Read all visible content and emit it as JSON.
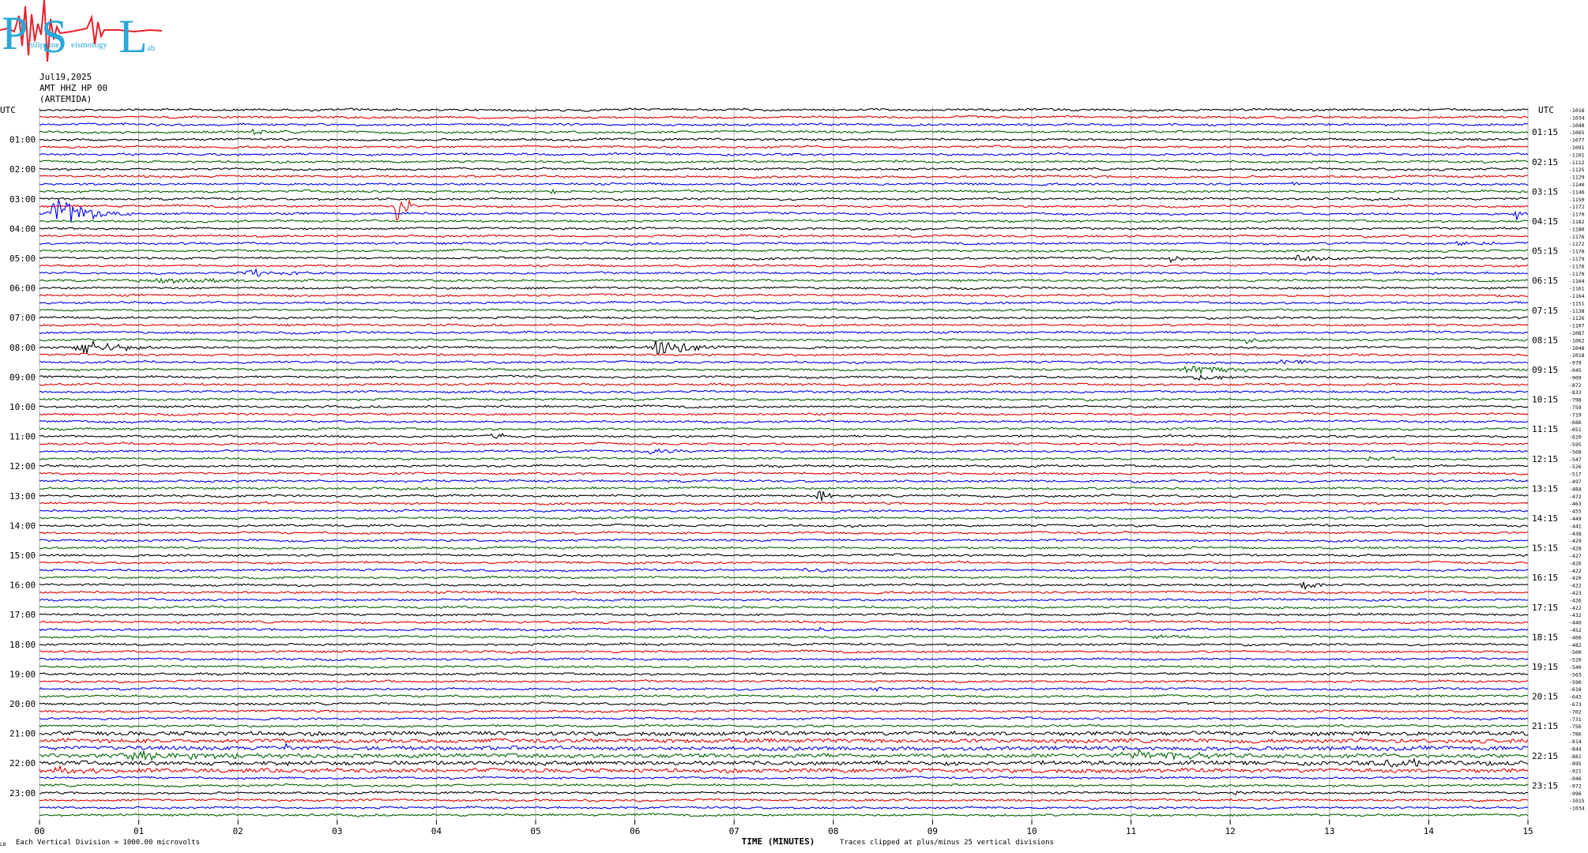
{
  "logo": {
    "big_letters": [
      "P",
      "S",
      "L"
    ],
    "small_words": [
      "hilippine",
      "eismology",
      "ab"
    ]
  },
  "header": {
    "date": "Jul19,2025",
    "channel": "AMT HHZ HP 00",
    "station": "(ARTEMIDA)"
  },
  "footer": {
    "scale_note": "Each Vertical Division = 1000.00 microvolts",
    "clip_note": "Traces clipped at plus/minus 25 vertical divisions",
    "corner_mark": "LB"
  },
  "colors": {
    "trace_cycle": [
      "#000000",
      "#e00000",
      "#0000ee",
      "#006400"
    ],
    "grid": "#b0b0b0"
  },
  "chart_data": {
    "type": "line",
    "title": "",
    "xlabel": "TIME (MINUTES)",
    "x_ticks": [
      "00",
      "01",
      "02",
      "03",
      "04",
      "05",
      "06",
      "07",
      "08",
      "09",
      "10",
      "11",
      "12",
      "13",
      "14",
      "15"
    ],
    "xlim": [
      0,
      15
    ],
    "left_axis_title": "UTC",
    "right_axis_title": "UTC",
    "left_hour_labels": [
      "01:00",
      "02:00",
      "03:00",
      "04:00",
      "05:00",
      "06:00",
      "07:00",
      "08:00",
      "09:00",
      "10:00",
      "11:00",
      "12:00",
      "13:00",
      "14:00",
      "15:00",
      "16:00",
      "17:00",
      "18:00",
      "19:00",
      "20:00",
      "21:00",
      "22:00",
      "23:00"
    ],
    "right_hour_labels": [
      "01:15",
      "02:15",
      "03:15",
      "04:15",
      "05:15",
      "06:15",
      "07:15",
      "08:15",
      "09:15",
      "10:15",
      "11:15",
      "12:15",
      "13:15",
      "14:15",
      "15:15",
      "16:15",
      "17:15",
      "18:15",
      "19:15",
      "20:15",
      "21:15",
      "22:15",
      "23:15"
    ],
    "trace_count": 96,
    "minutes_per_trace": 15,
    "right_offsets": [
      "-1016",
      "-1034",
      "-1048",
      "-1065",
      "-1077",
      "-1091",
      "-1101",
      "-1112",
      "-1125",
      "-1129",
      "-1140",
      "-1146",
      "-1150",
      "-1172",
      "-1170",
      "-1182",
      "-1180",
      "-1176",
      "-1172",
      "-1170",
      "-1179",
      "-1176",
      "-1170",
      "-1164",
      "-1161",
      "-1164",
      "-1151",
      "-1138",
      "-1126",
      "-1107",
      "-1087",
      "-1062",
      "-1048",
      "-1018",
      "-979",
      "-945",
      "-909",
      "-872",
      "-833",
      "-798",
      "-759",
      "-719",
      "-686",
      "-651",
      "-620",
      "-595",
      "-568",
      "-547",
      "-526",
      "-517",
      "-497",
      "-484",
      "-472",
      "-463",
      "-455",
      "-449",
      "-441",
      "-438",
      "-429",
      "-428",
      "-427",
      "-426",
      "-422",
      "-420",
      "-422",
      "-423",
      "-426",
      "-422",
      "-432",
      "-440",
      "-452",
      "-466",
      "-482",
      "-500",
      "-520",
      "-540",
      "-563",
      "-590",
      "-618",
      "-643",
      "-673",
      "-702",
      "-731",
      "-756",
      "-786",
      "-814",
      "-844",
      "-881",
      "-895",
      "-921",
      "-946",
      "-972",
      "-996",
      "-1015",
      "-1034"
    ],
    "events": [
      {
        "trace": 3,
        "minute": 2.1,
        "amplitude": 3.5,
        "duration": 0.35
      },
      {
        "trace": 2,
        "minute": 9.4,
        "amplitude": 2.5,
        "duration": 0.3
      },
      {
        "trace": 7,
        "minute": 8.6,
        "amplitude": 2.5,
        "duration": 0.2
      },
      {
        "trace": 10,
        "minute": 12.6,
        "amplitude": 4,
        "duration": 0.2
      },
      {
        "trace": 11,
        "minute": 5.1,
        "amplitude": 3,
        "duration": 0.5
      },
      {
        "trace": 13,
        "minute": 3.55,
        "amplitude": 22,
        "duration": 0.35
      },
      {
        "trace": 14,
        "minute": 0.05,
        "amplitude": 22,
        "duration": 0.9
      },
      {
        "trace": 14,
        "minute": 14.85,
        "amplitude": 13,
        "duration": 0.15
      },
      {
        "trace": 18,
        "minute": 14.2,
        "amplitude": 3,
        "duration": 0.8
      },
      {
        "trace": 20,
        "minute": 11.3,
        "amplitude": 4,
        "duration": 0.6
      },
      {
        "trace": 20,
        "minute": 12.6,
        "amplitude": 5,
        "duration": 0.7
      },
      {
        "trace": 22,
        "minute": 2.0,
        "amplitude": 5,
        "duration": 1.2
      },
      {
        "trace": 23,
        "minute": 0.8,
        "amplitude": 3,
        "duration": 2.8
      },
      {
        "trace": 32,
        "minute": 0.3,
        "amplitude": 10,
        "duration": 1.0
      },
      {
        "trace": 32,
        "minute": 6.1,
        "amplitude": 12,
        "duration": 1.0
      },
      {
        "trace": 31,
        "minute": 12.1,
        "amplitude": 4,
        "duration": 0.4
      },
      {
        "trace": 34,
        "minute": 12.4,
        "amplitude": 3,
        "duration": 0.8
      },
      {
        "trace": 35,
        "minute": 11.4,
        "amplitude": 5,
        "duration": 1.6
      },
      {
        "trace": 36,
        "minute": 11.6,
        "amplitude": 5,
        "duration": 0.6
      },
      {
        "trace": 44,
        "minute": 4.5,
        "amplitude": 5,
        "duration": 0.4
      },
      {
        "trace": 46,
        "minute": 6.0,
        "amplitude": 4,
        "duration": 0.8
      },
      {
        "trace": 47,
        "minute": 13.3,
        "amplitude": 4,
        "duration": 0.8
      },
      {
        "trace": 52,
        "minute": 7.8,
        "amplitude": 8,
        "duration": 0.4
      },
      {
        "trace": 55,
        "minute": 5.7,
        "amplitude": 2.5,
        "duration": 0.6
      },
      {
        "trace": 62,
        "minute": 7.6,
        "amplitude": 3,
        "duration": 1.2
      },
      {
        "trace": 64,
        "minute": 12.7,
        "amplitude": 8,
        "duration": 0.3
      },
      {
        "trace": 70,
        "minute": 7.8,
        "amplitude": 4,
        "duration": 0.4
      },
      {
        "trace": 71,
        "minute": 11.1,
        "amplitude": 3,
        "duration": 0.8
      },
      {
        "trace": 78,
        "minute": 8.3,
        "amplitude": 2.5,
        "duration": 0.6
      },
      {
        "trace": 86,
        "minute": 2.4,
        "amplitude": 4,
        "duration": 0.5
      },
      {
        "trace": 87,
        "minute": 0.6,
        "amplitude": 5,
        "duration": 3.0
      },
      {
        "trace": 87,
        "minute": 10.8,
        "amplitude": 6,
        "duration": 2.0
      },
      {
        "trace": 88,
        "minute": 13.4,
        "amplitude": 5,
        "duration": 1.6
      },
      {
        "trace": 89,
        "minute": 0.1,
        "amplitude": 5,
        "duration": 1.0
      },
      {
        "trace": 92,
        "minute": 12.0,
        "amplitude": 3,
        "duration": 0.3
      }
    ],
    "grid": true
  }
}
